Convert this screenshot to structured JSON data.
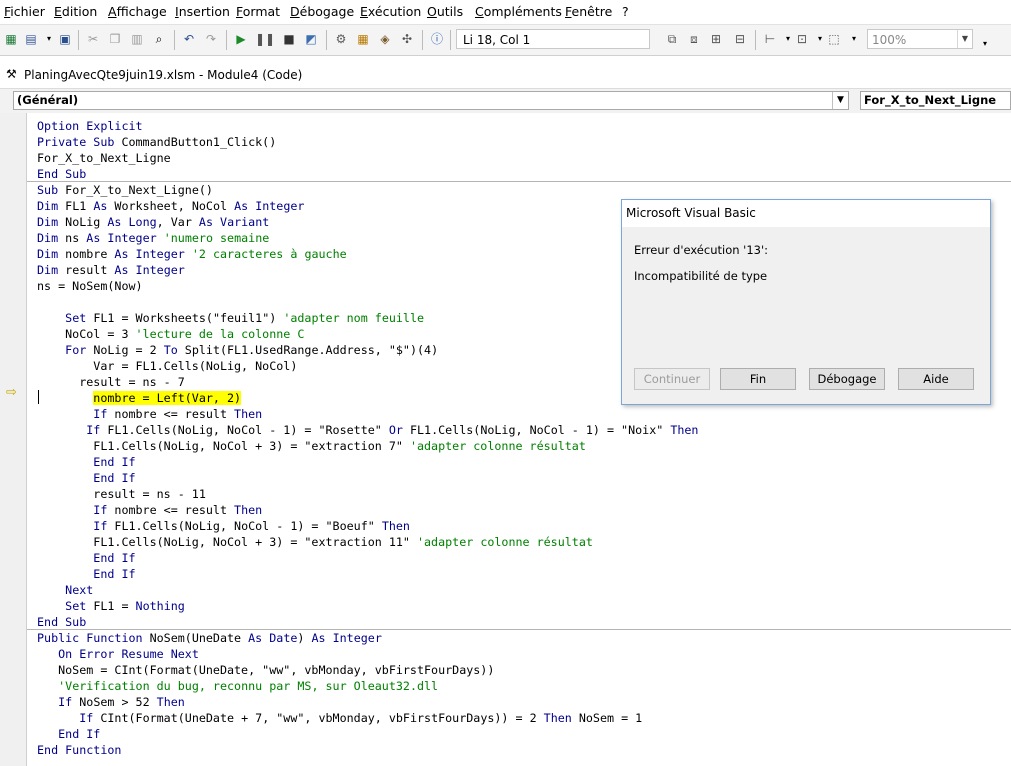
{
  "menu": [
    "Fichier",
    "Edition",
    "Affichage",
    "Insertion",
    "Format",
    "Débogage",
    "Exécution",
    "Outils",
    "Compléments",
    "Fenêtre",
    "?"
  ],
  "toolbar": {
    "position_text": "Li 18, Col 1",
    "zoom_text": "100%"
  },
  "window": {
    "title": "PlaningAvecQte9juin19.xlsm - Module4 (Code)"
  },
  "procbar": {
    "object_value": "(Général)",
    "procedure_value": "For_X_to_Next_Ligne"
  },
  "code_lines": [
    [
      {
        "t": "Option Explicit",
        "c": "kw"
      }
    ],
    [
      {
        "t": "Private Sub",
        "c": "kw"
      },
      {
        "t": " CommandButton1_Click()"
      }
    ],
    [
      {
        "t": "For_X_to_Next_Ligne"
      }
    ],
    [
      {
        "t": "End Sub",
        "c": "kw"
      }
    ],
    [
      {
        "t": "Sub",
        "c": "kw"
      },
      {
        "t": " For_X_to_Next_Ligne()"
      }
    ],
    [
      {
        "t": "Dim",
        "c": "kw"
      },
      {
        "t": " FL1 "
      },
      {
        "t": "As",
        "c": "kw"
      },
      {
        "t": " Worksheet, NoCol "
      },
      {
        "t": "As",
        "c": "kw"
      },
      {
        "t": " "
      },
      {
        "t": "Integer",
        "c": "kw"
      }
    ],
    [
      {
        "t": "Dim",
        "c": "kw"
      },
      {
        "t": " NoLig "
      },
      {
        "t": "As",
        "c": "kw"
      },
      {
        "t": " "
      },
      {
        "t": "Long",
        "c": "kw"
      },
      {
        "t": ", Var "
      },
      {
        "t": "As",
        "c": "kw"
      },
      {
        "t": " "
      },
      {
        "t": "Variant",
        "c": "kw"
      }
    ],
    [
      {
        "t": "Dim",
        "c": "kw"
      },
      {
        "t": " ns "
      },
      {
        "t": "As",
        "c": "kw"
      },
      {
        "t": " "
      },
      {
        "t": "Integer",
        "c": "kw"
      },
      {
        "t": " "
      },
      {
        "t": "'numero semaine",
        "c": "cm"
      }
    ],
    [
      {
        "t": "Dim",
        "c": "kw"
      },
      {
        "t": " nombre "
      },
      {
        "t": "As",
        "c": "kw"
      },
      {
        "t": " "
      },
      {
        "t": "Integer",
        "c": "kw"
      },
      {
        "t": " "
      },
      {
        "t": "'2 caracteres à gauche",
        "c": "cm"
      }
    ],
    [
      {
        "t": "Dim",
        "c": "kw"
      },
      {
        "t": " result "
      },
      {
        "t": "As",
        "c": "kw"
      },
      {
        "t": " "
      },
      {
        "t": "Integer",
        "c": "kw"
      }
    ],
    [
      {
        "t": "ns = NoSem(Now)"
      }
    ],
    [
      {
        "t": ""
      }
    ],
    [
      {
        "t": "    "
      },
      {
        "t": "Set",
        "c": "kw"
      },
      {
        "t": " FL1 = Worksheets(\"feuil1\") "
      },
      {
        "t": "'adapter nom feuille",
        "c": "cm"
      }
    ],
    [
      {
        "t": "    NoCol = 3 "
      },
      {
        "t": "'lecture de la colonne C",
        "c": "cm"
      }
    ],
    [
      {
        "t": "    "
      },
      {
        "t": "For",
        "c": "kw"
      },
      {
        "t": " NoLig = 2 "
      },
      {
        "t": "To",
        "c": "kw"
      },
      {
        "t": " Split(FL1.UsedRange.Address, \"$\")(4)"
      }
    ],
    [
      {
        "t": "        Var = FL1.Cells(NoLig, NoCol)"
      }
    ],
    [
      {
        "t": "      result = ns - 7"
      }
    ],
    [
      {
        "t": "        "
      },
      {
        "t": "nombre = Left(Var, 2)",
        "c": "hl"
      }
    ],
    [
      {
        "t": "        "
      },
      {
        "t": "If",
        "c": "kw"
      },
      {
        "t": " nombre <= result "
      },
      {
        "t": "Then",
        "c": "kw"
      }
    ],
    [
      {
        "t": "       "
      },
      {
        "t": "If",
        "c": "kw"
      },
      {
        "t": " FL1.Cells(NoLig, NoCol - 1) = \"Rosette\" "
      },
      {
        "t": "Or",
        "c": "kw"
      },
      {
        "t": " FL1.Cells(NoLig, NoCol - 1) = \"Noix\" "
      },
      {
        "t": "Then",
        "c": "kw"
      }
    ],
    [
      {
        "t": "        FL1.Cells(NoLig, NoCol + 3) = \"extraction 7\" "
      },
      {
        "t": "'adapter colonne résultat",
        "c": "cm"
      }
    ],
    [
      {
        "t": "        "
      },
      {
        "t": "End If",
        "c": "kw"
      }
    ],
    [
      {
        "t": "        "
      },
      {
        "t": "End If",
        "c": "kw"
      }
    ],
    [
      {
        "t": "        result = ns - 11"
      }
    ],
    [
      {
        "t": "        "
      },
      {
        "t": "If",
        "c": "kw"
      },
      {
        "t": " nombre <= result "
      },
      {
        "t": "Then",
        "c": "kw"
      }
    ],
    [
      {
        "t": "        "
      },
      {
        "t": "If",
        "c": "kw"
      },
      {
        "t": " FL1.Cells(NoLig, NoCol - 1) = \"Boeuf\" "
      },
      {
        "t": "Then",
        "c": "kw"
      }
    ],
    [
      {
        "t": "        FL1.Cells(NoLig, NoCol + 3) = \"extraction 11\" "
      },
      {
        "t": "'adapter colonne résultat",
        "c": "cm"
      }
    ],
    [
      {
        "t": "        "
      },
      {
        "t": "End If",
        "c": "kw"
      }
    ],
    [
      {
        "t": "        "
      },
      {
        "t": "End If",
        "c": "kw"
      }
    ],
    [
      {
        "t": "    "
      },
      {
        "t": "Next",
        "c": "kw"
      }
    ],
    [
      {
        "t": "    "
      },
      {
        "t": "Set",
        "c": "kw"
      },
      {
        "t": " FL1 = "
      },
      {
        "t": "Nothing",
        "c": "kw"
      }
    ],
    [
      {
        "t": "End Sub",
        "c": "kw"
      }
    ],
    [
      {
        "t": "Public Function",
        "c": "kw"
      },
      {
        "t": " NoSem(UneDate "
      },
      {
        "t": "As",
        "c": "kw"
      },
      {
        "t": " "
      },
      {
        "t": "Date",
        "c": "kw"
      },
      {
        "t": ") "
      },
      {
        "t": "As",
        "c": "kw"
      },
      {
        "t": " "
      },
      {
        "t": "Integer",
        "c": "kw"
      }
    ],
    [
      {
        "t": "   "
      },
      {
        "t": "On Error Resume Next",
        "c": "kw"
      }
    ],
    [
      {
        "t": "   NoSem = CInt(Format(UneDate, \"ww\", vbMonday, vbFirstFourDays))"
      }
    ],
    [
      {
        "t": "   "
      },
      {
        "t": "'Verification du bug, reconnu par MS, sur Oleaut32.dll",
        "c": "cm"
      }
    ],
    [
      {
        "t": "   "
      },
      {
        "t": "If",
        "c": "kw"
      },
      {
        "t": " NoSem > 52 "
      },
      {
        "t": "Then",
        "c": "kw"
      }
    ],
    [
      {
        "t": "      "
      },
      {
        "t": "If",
        "c": "kw"
      },
      {
        "t": " CInt(Format(UneDate + 7, \"ww\", vbMonday, vbFirstFourDays)) = 2 "
      },
      {
        "t": "Then",
        "c": "kw"
      },
      {
        "t": " NoSem = 1"
      }
    ],
    [
      {
        "t": "   "
      },
      {
        "t": "End If",
        "c": "kw"
      }
    ],
    [
      {
        "t": "End Function",
        "c": "kw"
      }
    ]
  ],
  "dialog": {
    "title": "Microsoft Visual Basic",
    "message_line1": "Erreur d'exécution '13':",
    "message_line2": "Incompatibilité de type",
    "buttons": {
      "continue": "Continuer",
      "end": "Fin",
      "debug": "Débogage",
      "help": "Aide"
    }
  }
}
